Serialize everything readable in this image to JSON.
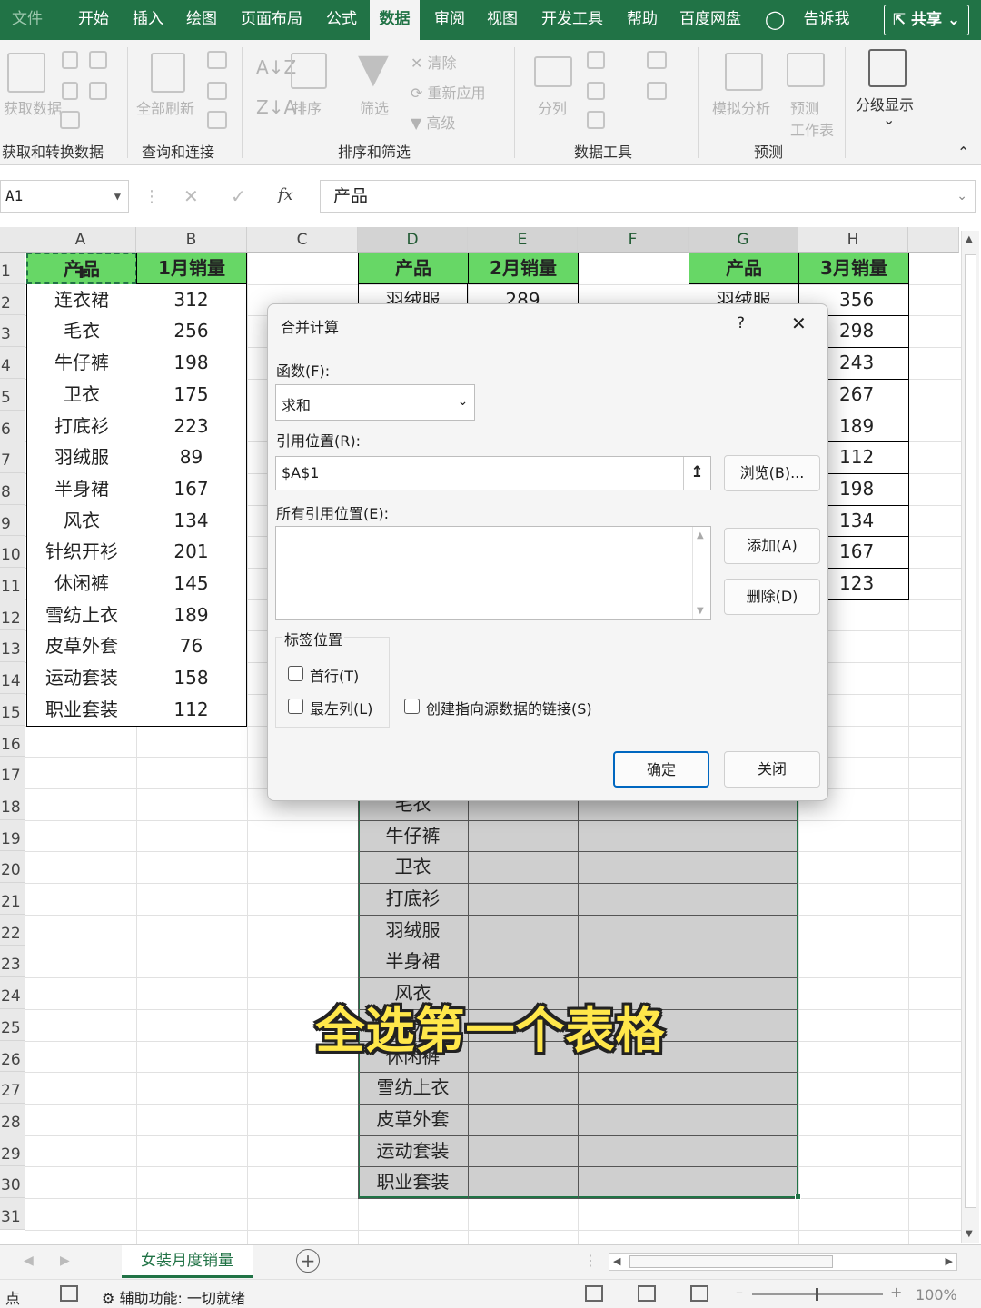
{
  "ribbon_tabs": [
    "文件",
    "开始",
    "插入",
    "绘图",
    "页面布局",
    "公式",
    "数据",
    "审阅",
    "视图",
    "开发工具",
    "帮助",
    "百度网盘",
    "告诉我"
  ],
  "active_tab": "数据",
  "share_label": "共享",
  "ribbon": {
    "get_data": "获取数据",
    "refresh_all": "全部刷新",
    "sort": "排序",
    "filter": "筛选",
    "clear": "清除",
    "reapply": "重新应用",
    "advanced": "高级",
    "split": "分列",
    "what_if": "模拟分析",
    "forecast_sheet_1": "预测",
    "forecast_sheet_2": "工作表",
    "outline": "分级显示",
    "group_get_transform": "获取和转换数据",
    "group_queries": "查询和连接",
    "group_sort_filter": "排序和筛选",
    "group_data_tools": "数据工具",
    "group_forecast": "预测"
  },
  "formula_bar": {
    "name_box": "A1",
    "formula": "产品",
    "fx": "fx"
  },
  "columns": [
    "A",
    "B",
    "C",
    "D",
    "E",
    "F",
    "G",
    "H"
  ],
  "rows": [
    "1",
    "2",
    "3",
    "4",
    "5",
    "6",
    "7",
    "8",
    "9",
    "10",
    "11",
    "12",
    "13",
    "14",
    "15",
    "16",
    "17",
    "18",
    "19",
    "20",
    "21",
    "22",
    "23",
    "24",
    "25",
    "26",
    "27",
    "28",
    "29",
    "30",
    "31"
  ],
  "table1": {
    "headers": [
      "产品",
      "1月销量"
    ],
    "rows": [
      [
        "连衣裙",
        "312"
      ],
      [
        "毛衣",
        "256"
      ],
      [
        "牛仔裤",
        "198"
      ],
      [
        "卫衣",
        "175"
      ],
      [
        "打底衫",
        "223"
      ],
      [
        "羽绒服",
        "89"
      ],
      [
        "半身裙",
        "167"
      ],
      [
        "风衣",
        "134"
      ],
      [
        "针织开衫",
        "201"
      ],
      [
        "休闲裤",
        "145"
      ],
      [
        "雪纺上衣",
        "189"
      ],
      [
        "皮草外套",
        "76"
      ],
      [
        "运动套装",
        "158"
      ],
      [
        "职业套装",
        "112"
      ]
    ]
  },
  "table2": {
    "headers": [
      "产品",
      "2月销量"
    ],
    "first_row": [
      "羽绒服",
      "289"
    ]
  },
  "table3": {
    "headers": [
      "产品",
      "3月销量"
    ],
    "first_product": "羽绒服",
    "values": [
      "356",
      "298",
      "243",
      "267",
      "189",
      "112",
      "198",
      "134",
      "167",
      "123"
    ]
  },
  "result_products": [
    "毛衣",
    "牛仔裤",
    "卫衣",
    "打底衫",
    "羽绒服",
    "半身裙",
    "风衣",
    "针织开衫",
    "休闲裤",
    "雪纺上衣",
    "皮草外套",
    "运动套装",
    "职业套装"
  ],
  "dialog": {
    "title": "合并计算",
    "help": "?",
    "close_x": "✕",
    "function_label": "函数(F):",
    "function_value": "求和",
    "reference_label": "引用位置(R):",
    "reference_value": "$A$1",
    "browse": "浏览(B)...",
    "all_refs_label": "所有引用位置(E):",
    "add": "添加(A)",
    "delete": "删除(D)",
    "label_position": "标签位置",
    "top_row": "首行(T)",
    "left_column": "最左列(L)",
    "create_links": "创建指向源数据的链接(S)",
    "ok": "确定",
    "close": "关闭"
  },
  "sheet_tab": "女装月度销量",
  "status": {
    "mode": "点",
    "accessibility": "辅助功能: 一切就绪",
    "zoom": "100%"
  },
  "caption": "全选第一个表格"
}
